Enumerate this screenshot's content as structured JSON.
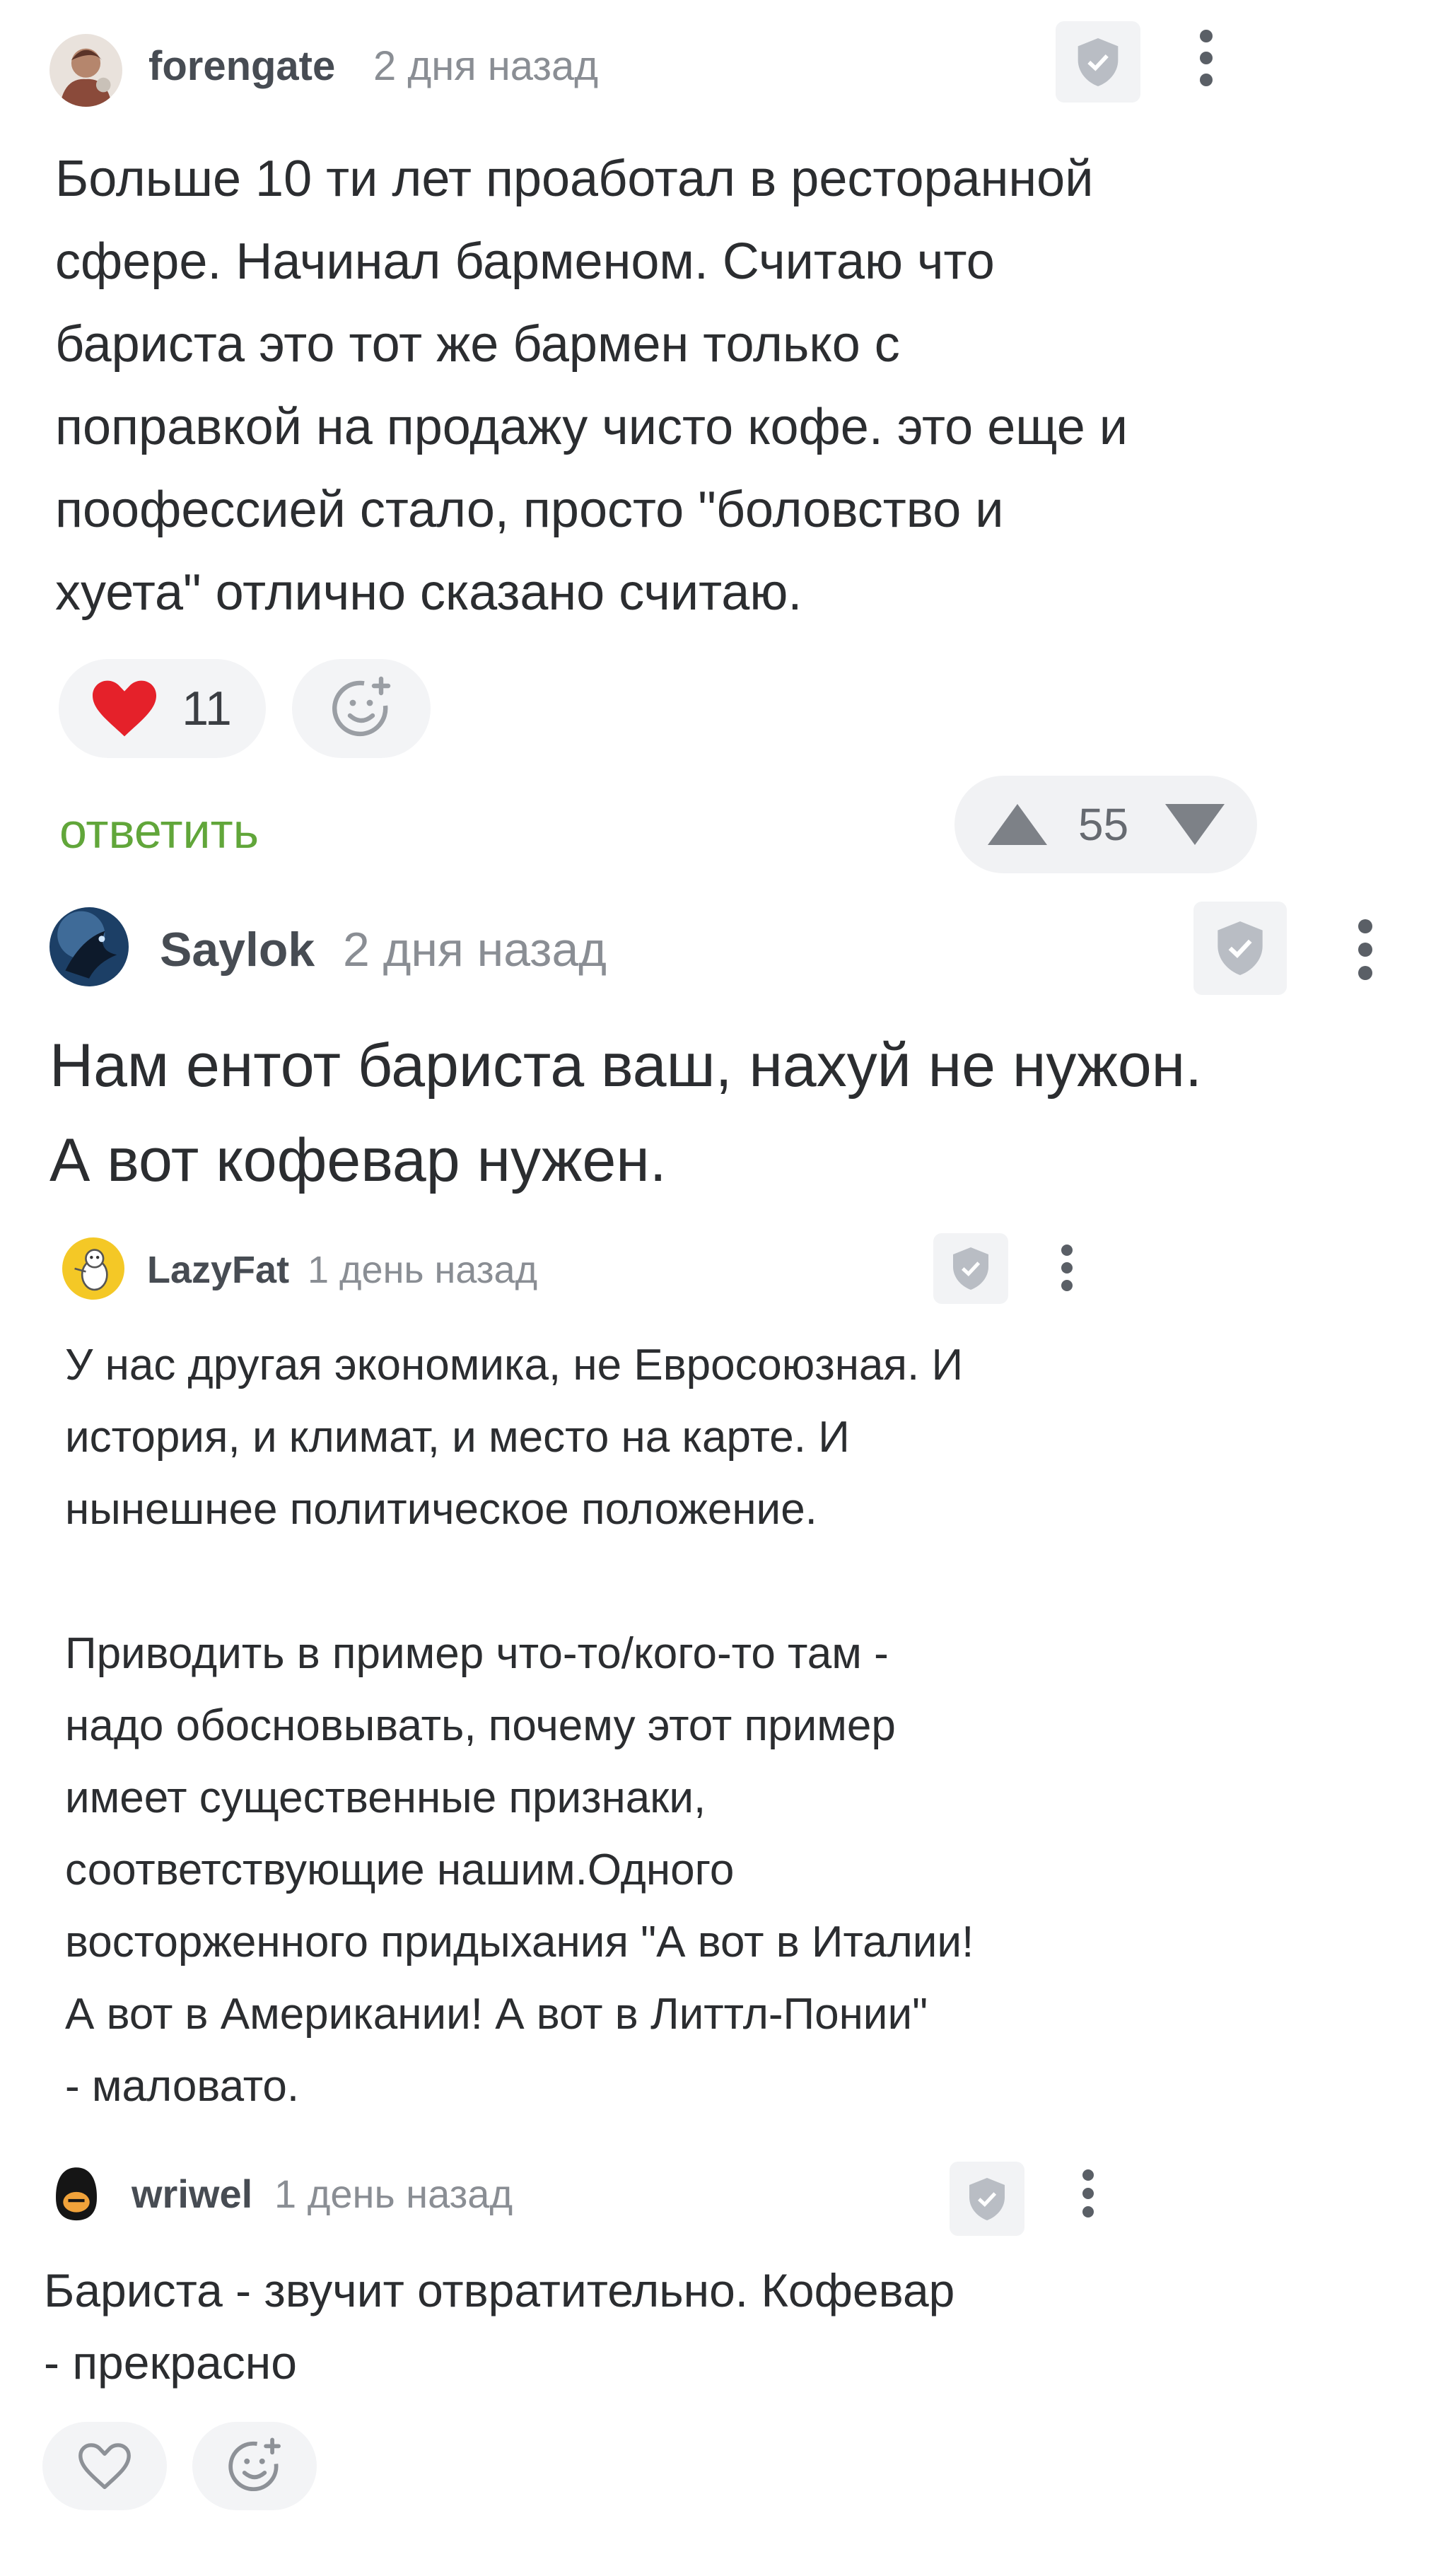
{
  "comments": [
    {
      "user": "forengate",
      "time": "2 дня назад",
      "lines": [
        "Больше 10 ти лет проаботал в ресторанной",
        "сфере. Начинал барменом. Считаю что",
        "бариста это тот же бармен только с",
        "поправкой на продажу чисто кофе. это еще и",
        "пoофессией стало, просто \"боловство и",
        "хуета\" отлично сказано считаю."
      ],
      "likes": "11",
      "reply_label": "ответить",
      "rating": "55"
    },
    {
      "user": "Saylok",
      "time": "2 дня назад",
      "lines": [
        "Нам ентот бариста ваш, нахуй не нужон.",
        "А вот кофевар нужен."
      ]
    },
    {
      "user": "LazyFat",
      "time": "1 день назад",
      "lines": [
        "У нас другая экономика, не Евросоюзная. И",
        "история, и климат, и место на карте. И",
        "нынешнее политическое положение.",
        "",
        "Приводить в пример что-то/кого-то там -",
        "надо обосновывать, почему этот пример",
        "имеет существенные признаки,",
        "соответствующие нашим.Одного",
        "восторженного придыхания \"А вот в Италии!",
        "А вот в Американии! А вот в Литтл-Понии\"",
        "- маловато."
      ]
    },
    {
      "user": "wriwel",
      "time": "1 день назад",
      "lines": [
        "Бариста - звучит отвратительно. Кофевар",
        "- прекрасно"
      ]
    }
  ],
  "icons": {
    "shield": "shield-check-icon",
    "more": "more-vertical-icon",
    "heart_filled": "heart-filled-icon",
    "heart_outline": "heart-outline-icon",
    "emoji_add": "emoji-add-icon",
    "vote_up": "arrow-up-icon",
    "vote_down": "arrow-down-icon"
  },
  "colors": {
    "accent_green": "#61a63a",
    "heart_red": "#e5212a",
    "username": "#474c53",
    "time": "#8a8e94",
    "pill_bg": "#f3f4f6"
  }
}
